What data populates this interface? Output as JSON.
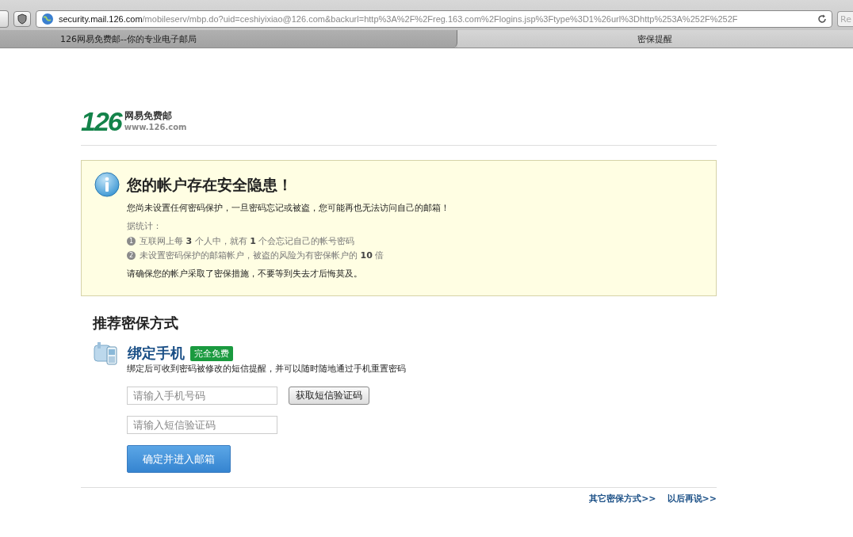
{
  "toolbar": {
    "url_host": "security.mail.126.com",
    "url_path": "/mobileserv/mbp.do?uid=ceshiyixiao@126.com&backurl=http%3A%2F%2Freg.163.com%2Flogins.jsp%3Ftype%3D1%26url%3Dhttp%253A%252F%252F",
    "reader_label": "Re"
  },
  "tabs": [
    {
      "label": "126网易免费邮--你的专业电子邮局",
      "selected": false
    },
    {
      "label": "密保提醒",
      "selected": true
    }
  ],
  "logo": {
    "mark": "126",
    "name": "网易免费邮",
    "site": "www.126.com"
  },
  "alert": {
    "title": "您的帐户存在安全隐患！",
    "message": "您尚未设置任何密码保护，一旦密码忘记或被盗，您可能再也无法访问自己的邮箱！",
    "stats_label": "据统计：",
    "stats": [
      {
        "number": "1",
        "text": "互联网上每 **3** 个人中，就有 **1** 个会忘记自己的帐号密码"
      },
      {
        "number": "2",
        "text": "未设置密码保护的邮箱帐户，被盗的风险为有密保帐户的 **10** 倍"
      }
    ],
    "advice": "请确保您的帐户采取了密保措施，不要等到失去才后悔莫及。"
  },
  "section": {
    "heading": "推荐密保方式",
    "method_title": "绑定手机",
    "badge": "完全免费",
    "description": "绑定后可收到密码被修改的短信提醒，并可以随时随地通过手机重置密码",
    "phone_field": {
      "placeholder": "请输入手机号码"
    },
    "get_code_button": "获取短信验证码",
    "code_field": {
      "placeholder": "请输入短信验证码"
    },
    "submit_button": "确定并进入邮箱"
  },
  "footer_links": [
    "其它密保方式>>",
    "以后再说>>"
  ]
}
